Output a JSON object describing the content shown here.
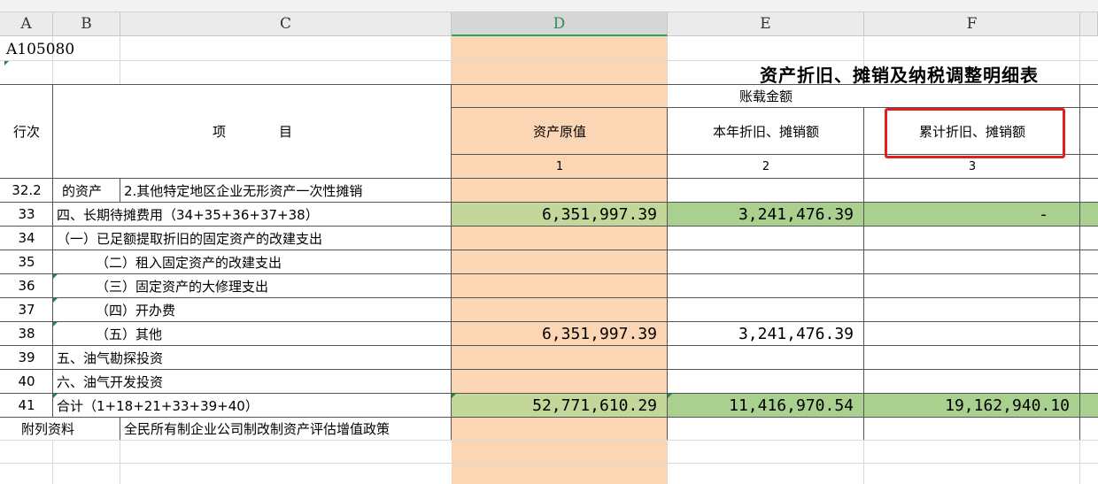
{
  "columns": [
    "A",
    "B",
    "C",
    "D",
    "E",
    "F"
  ],
  "selected_column": "D",
  "form_code": "A105080",
  "title": "资产折旧、摊销及纳税调整明细表",
  "header": {
    "row_no": "行次",
    "item": "项　　　　目",
    "book_amount": "账载金额",
    "original_value": "资产原值",
    "current_year": "本年折旧、摊销额",
    "accumulated": "累计折旧、摊销额",
    "col1": "1",
    "col2": "2",
    "col3": "3"
  },
  "rows": [
    {
      "no": "32.2",
      "b": "的资产",
      "c": "2.其他特定地区企业无形资产一次性摊销",
      "d": "",
      "e": "",
      "f": ""
    },
    {
      "no": "33",
      "b": "四、长期待摊费用（34+35+36+37+38）",
      "c": "",
      "d": "6,351,997.39",
      "e": "3,241,476.39",
      "f": "-"
    },
    {
      "no": "34",
      "b": "（一）已足额提取折旧的固定资产的改建支出",
      "c": "",
      "d": "",
      "e": "",
      "f": ""
    },
    {
      "no": "35",
      "b": "（二）租入固定资产的改建支出",
      "c": "",
      "d": "",
      "e": "",
      "f": ""
    },
    {
      "no": "36",
      "b": "（三）固定资产的大修理支出",
      "c": "",
      "d": "",
      "e": "",
      "f": ""
    },
    {
      "no": "37",
      "b": "（四）开办费",
      "c": "",
      "d": "",
      "e": "",
      "f": ""
    },
    {
      "no": "38",
      "b": "（五）其他",
      "c": "",
      "d": "6,351,997.39",
      "e": "3,241,476.39",
      "f": ""
    },
    {
      "no": "39",
      "b": "五、油气勘探投资",
      "c": "",
      "d": "",
      "e": "",
      "f": ""
    },
    {
      "no": "40",
      "b": "六、油气开发投资",
      "c": "",
      "d": "",
      "e": "",
      "f": ""
    },
    {
      "no": "41",
      "b": "合计（1+18+21+33+39+40）",
      "c": "",
      "d": "52,771,610.29",
      "e": "11,416,970.54",
      "f": "19,162,940.10"
    }
  ],
  "appendix": {
    "label": "附列资料",
    "text": "全民所有制企业公司制改制资产评估增值政策"
  },
  "colors": {
    "selected_col_fill": "#fcd5b4",
    "total_fill": "#c4d79b",
    "highlight_box": "#e02020"
  }
}
